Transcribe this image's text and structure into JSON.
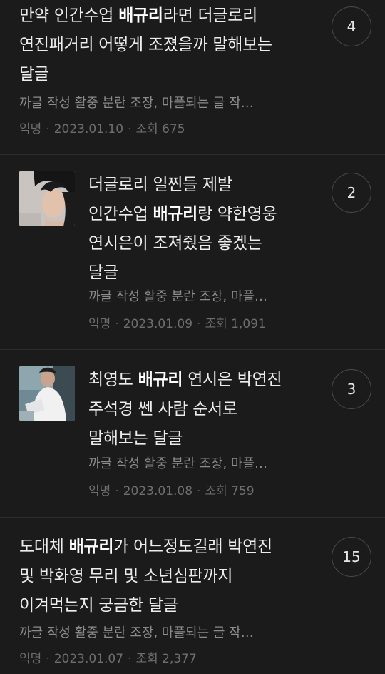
{
  "posts": [
    {
      "title_parts": [
        "만약 인간수업 ",
        "배규리",
        "라면 더글로리\n연진패거리 어떻게 조졌을까 말해보는\n달글"
      ],
      "preview": "까글 작성 활중 분란 조장, 마플되는 글 작…",
      "author": "익명",
      "date": "2023.01.10",
      "views": "조회 675",
      "comments": "4",
      "has_thumb": false
    },
    {
      "title_parts": [
        "더글로리 일찐들 제발\n인간수업 ",
        "배규리",
        "랑 약한영웅\n연시은이 조져줬음 좋겠는\n달글"
      ],
      "preview": "까글 작성 활중 분란 조장, 마플…",
      "author": "익명",
      "date": "2023.01.09",
      "views": "조회 1,091",
      "comments": "2",
      "has_thumb": true,
      "thumb_icon": "woman-portrait-photo"
    },
    {
      "title_parts": [
        "최영도 ",
        "배규리",
        " 연시은 박연진\n주석경 쎈 사람 순서로\n말해보는 달글"
      ],
      "preview": "까글 작성 활중 분란 조장, 마플…",
      "author": "익명",
      "date": "2023.01.08",
      "views": "조회 759",
      "comments": "3",
      "has_thumb": true,
      "thumb_icon": "student-photo"
    },
    {
      "title_parts": [
        "도대체 ",
        "배규리",
        "가 어느정도길래 박연진\n및 박화영 무리 및 소년심판까지\n이겨먹는지 궁금한 달글"
      ],
      "preview": "까글 작성 활중 분란 조장, 마플되는 글 작…",
      "author": "익명",
      "date": "2023.01.07",
      "views": "조회 2,377",
      "comments": "15",
      "has_thumb": false
    }
  ]
}
